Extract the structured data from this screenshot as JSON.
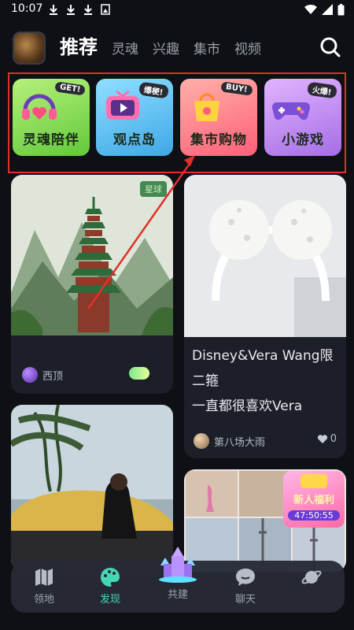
{
  "status_bar": {
    "time": "10:07"
  },
  "top_nav": {
    "tabs": [
      {
        "label": "推荐"
      },
      {
        "label": "灵魂"
      },
      {
        "label": "兴趣"
      },
      {
        "label": "集市"
      },
      {
        "label": "视频"
      }
    ],
    "active_index": 0
  },
  "categories": [
    {
      "label": "灵魂陪伴",
      "badge": "GET!",
      "color": "#8ee05a",
      "icon": "headphone-heart-icon"
    },
    {
      "label": "观点岛",
      "badge": "爆梗!",
      "color": "#5ec2ee",
      "icon": "tv-play-icon"
    },
    {
      "label": "集市购物",
      "badge": "BUY!",
      "color": "#ff7d8a",
      "icon": "shopping-bag-icon"
    },
    {
      "label": "小游戏",
      "badge": "火爆!",
      "color": "#c889ee",
      "icon": "gamepad-icon"
    }
  ],
  "feed": {
    "left": [
      {
        "tag": "星球",
        "author": "西顶",
        "image": "pagoda-painting"
      },
      {
        "image": "woman-car-beach"
      }
    ],
    "right": [
      {
        "title": "Disney&Vera Wang限\n   二箍\n一直都很喜欢Vera",
        "author": "第八场大雨",
        "likes": "0",
        "image": "lace-headband"
      },
      {
        "promo_title": "新人福利",
        "promo_timer": "47:50:55",
        "image": "photo-collage"
      }
    ]
  },
  "bottom_nav": {
    "items": [
      {
        "label": "领地",
        "icon": "map-icon"
      },
      {
        "label": "发现",
        "icon": "palette-icon"
      },
      {
        "label": "共建",
        "icon": "crystal-castle-icon"
      },
      {
        "label": "聊天",
        "icon": "chat-bubble-icon"
      },
      {
        "label": "",
        "icon": "planet-icon"
      }
    ],
    "active_index": 1
  },
  "colors": {
    "accent": "#45d6b6",
    "annotation": "#e0302a",
    "background": "#0e1016"
  }
}
